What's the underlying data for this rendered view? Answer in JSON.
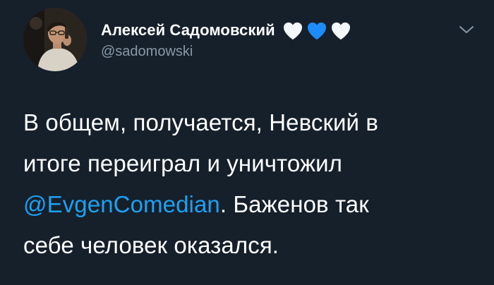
{
  "author": {
    "name": "Алексей Садомовский",
    "handle": "@sadomowski",
    "avatar_icon": "profile-photo",
    "hearts": [
      {
        "icon": "white-heart",
        "color": "#f5f8fa"
      },
      {
        "icon": "blue-heart",
        "color": "#1d8cf8"
      },
      {
        "icon": "white-heart",
        "color": "#f5f8fa"
      }
    ]
  },
  "menu": {
    "icon": "chevron-down-icon",
    "color": "#8899a6"
  },
  "tweet": {
    "line1": "В общем, получается, Невский в",
    "line2": "итоге переиграл и уничтожил",
    "mention": "@EvgenComedian",
    "line3_rest": ". Баженов так",
    "line4": "себе человек оказался."
  },
  "colors": {
    "background": "#15202b",
    "text": "#ffffff",
    "secondary": "#8899a6",
    "link": "#1da1f2"
  }
}
